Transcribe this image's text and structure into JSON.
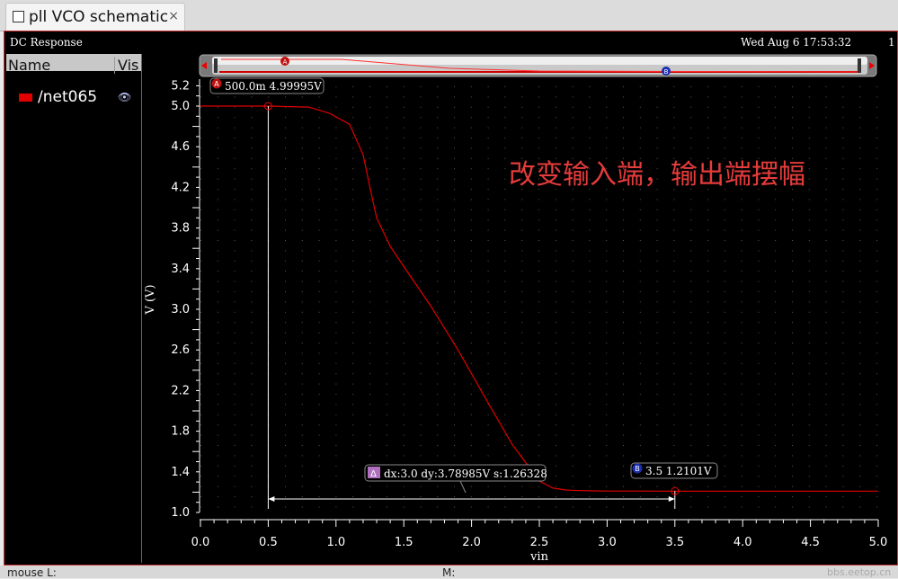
{
  "tab": {
    "title": "pll VCO schematic",
    "close": "×"
  },
  "window": {
    "title": "DC Response",
    "datetime": "Wed Aug 6 17:53:32",
    "subtitle_right": "1"
  },
  "side_panel": {
    "col_name": "Name",
    "col_vis": "Vis",
    "signals": [
      {
        "name": "/net065",
        "color": "#e00000",
        "vis_icon": "eye-icon"
      }
    ]
  },
  "annotation": "改变输入端，输出端摆幅",
  "markers": {
    "a": {
      "id": "A",
      "label": "500.0m 4.99995V",
      "x": 0.5,
      "y": 4.99995
    },
    "b": {
      "id": "B",
      "label": "3.5 1.2101V",
      "x": 3.5,
      "y": 1.2101
    },
    "delta": {
      "label": "dx:3.0 dy:3.78985V s:1.26328"
    }
  },
  "chart_data": {
    "type": "line",
    "title": "DC Response",
    "xlabel": "vin",
    "ylabel": "V (V)",
    "xlim": [
      0.0,
      5.0
    ],
    "ylim": [
      1.0,
      5.2
    ],
    "xticks": [
      "0.0",
      "0.5",
      "1.0",
      "1.5",
      "2.0",
      "2.5",
      "3.0",
      "3.5",
      "4.0",
      "4.5",
      "5.0"
    ],
    "yticks": [
      "1.0",
      "1.4",
      "1.8",
      "2.2",
      "2.6",
      "3.0",
      "3.4",
      "3.8",
      "4.2",
      "4.6",
      "5.0",
      "5.2"
    ],
    "grid": true,
    "series": [
      {
        "name": "/net065",
        "color": "#e00000",
        "x": [
          0.0,
          0.5,
          0.8,
          0.95,
          1.1,
          1.2,
          1.25,
          1.3,
          1.4,
          1.5,
          1.7,
          1.9,
          2.1,
          2.3,
          2.5,
          2.6,
          2.7,
          2.8,
          2.9,
          3.0,
          3.2,
          3.5,
          4.0,
          4.5,
          5.0
        ],
        "y": [
          5.0,
          5.0,
          4.99,
          4.93,
          4.82,
          4.52,
          4.2,
          3.9,
          3.62,
          3.42,
          3.03,
          2.6,
          2.13,
          1.67,
          1.31,
          1.24,
          1.22,
          1.215,
          1.212,
          1.211,
          1.211,
          1.21,
          1.21,
          1.21,
          1.21
        ]
      }
    ]
  }
}
